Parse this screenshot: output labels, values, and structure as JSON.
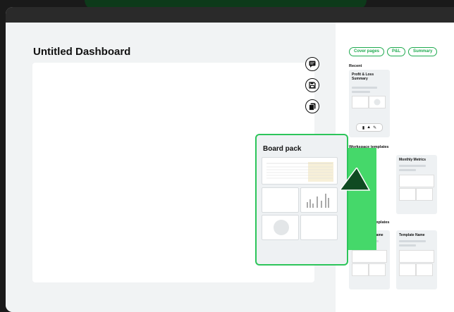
{
  "dashboard": {
    "title": "Untitled Dashboard"
  },
  "toolbar": {
    "comment_icon": "comment-icon",
    "save_icon": "save-icon",
    "copy_icon": "copy-icon"
  },
  "sidebar": {
    "chips": [
      "Cover pages",
      "P&L",
      "Summary"
    ],
    "recent_label": "Recent",
    "recent_card": {
      "title": "Profit & Loss Summary"
    },
    "workspace_label": "Workspace templates",
    "workspace_cards": [
      {
        "title": ""
      },
      {
        "title": "Monthly Metrics"
      }
    ],
    "community_label": "Community templates",
    "community_cards": [
      {
        "title": "Template Name"
      },
      {
        "title": "Template Name"
      }
    ]
  },
  "drag": {
    "title": "Board pack"
  },
  "colors": {
    "accent": "#2cc55a",
    "accent_light": "#45d86a",
    "cursor": "#0f4a22"
  }
}
